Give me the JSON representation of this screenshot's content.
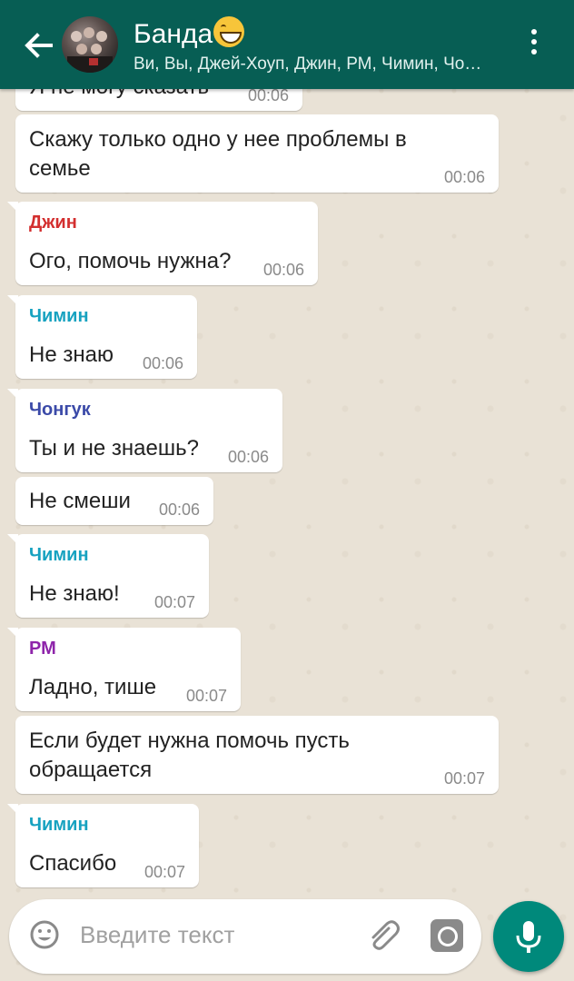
{
  "header": {
    "title": "Банда",
    "title_emoji": "grinning-face-emoji",
    "subtitle": "Ви, Вы, Джей-Хоуп, Джин, РМ, Чимин, Чо…",
    "background": "#075e54"
  },
  "messages": [
    {
      "sender": "",
      "text": "Я не могу сказать",
      "time": "00:06"
    },
    {
      "sender": "",
      "text": "Скажу только одно у нее проблемы в семье",
      "time": "00:06"
    },
    {
      "sender": "Джин",
      "sender_color": "#d32f2f",
      "text": "Ого, помочь нужна?",
      "time": "00:06"
    },
    {
      "sender": "Чимин",
      "sender_color": "#17a2c0",
      "text": "Не знаю",
      "time": "00:06"
    },
    {
      "sender": "Чонгук",
      "sender_color": "#3b4aa8",
      "text": "Ты и не знаешь?",
      "time": "00:06"
    },
    {
      "sender": "",
      "text": "Не смеши",
      "time": "00:06"
    },
    {
      "sender": "Чимин",
      "sender_color": "#17a2c0",
      "text": "Не знаю!",
      "time": "00:07"
    },
    {
      "sender": "РМ",
      "sender_color": "#8e24aa",
      "text": "Ладно, тише",
      "time": "00:07"
    },
    {
      "sender": "",
      "text": "Если будет нужна помочь пусть обращается",
      "time": "00:07"
    },
    {
      "sender": "Чимин",
      "sender_color": "#17a2c0",
      "text": "Спасибо",
      "time": "00:07"
    }
  ],
  "input": {
    "placeholder": "Введите текст",
    "icons": [
      "smiley-icon",
      "paperclip-icon",
      "camera-icon",
      "microphone-icon"
    ]
  },
  "accent": "#00897b"
}
